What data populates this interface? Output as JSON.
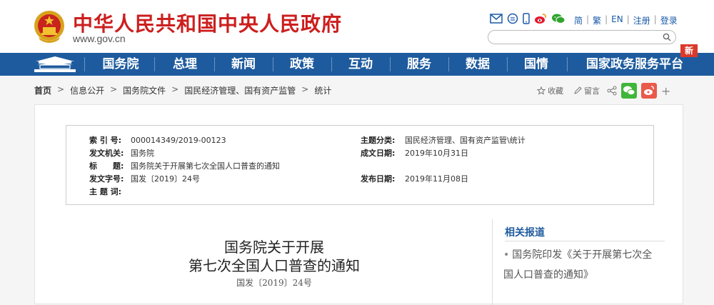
{
  "header": {
    "site_title": "中华人民共和国中央人民政府",
    "site_domain": "www.gov.cn",
    "links": [
      "简",
      "繁",
      "EN",
      "注册",
      "登录"
    ],
    "search_placeholder": ""
  },
  "nav": {
    "items": [
      "国务院",
      "总理",
      "新闻",
      "政策",
      "互动",
      "服务",
      "数据",
      "国情",
      "国家政务服务平台"
    ],
    "new_badge": "新"
  },
  "breadcrumb": {
    "items": [
      "首页",
      "信息公开",
      "国务院文件",
      "国民经济管理、国有资产监管",
      "统计"
    ]
  },
  "tools": {
    "favorite": "收藏",
    "comment": "留言"
  },
  "meta": {
    "index_label": "索 引 号:",
    "index_value": "000014349/2019-00123",
    "category_label": "主题分类:",
    "category_value": "国民经济管理、国有资产监管\\统计",
    "issuer_label": "发文机关:",
    "issuer_value": "国务院",
    "date_label": "成文日期:",
    "date_value": "2019年10月31日",
    "title_label": "标　　题:",
    "title_value": "国务院关于开展第七次全国人口普查的通知",
    "docno_label": "发文字号:",
    "docno_value": "国发〔2019〕24号",
    "pubdate_label": "发布日期:",
    "pubdate_value": "2019年11月08日",
    "keywords_label": "主 题 词:",
    "keywords_value": ""
  },
  "document": {
    "title_line1": "国务院关于开展",
    "title_line2": "第七次全国人口普查的通知",
    "doc_number": "国发〔2019〕24号"
  },
  "related": {
    "title": "相关报道",
    "items": [
      "国务院印发《关于开展第七次全国人口普查的通知》"
    ]
  },
  "colors": {
    "brand_red": "#cc1f1f",
    "nav_blue": "#1e5b9e",
    "new_badge": "#d93a2b"
  }
}
